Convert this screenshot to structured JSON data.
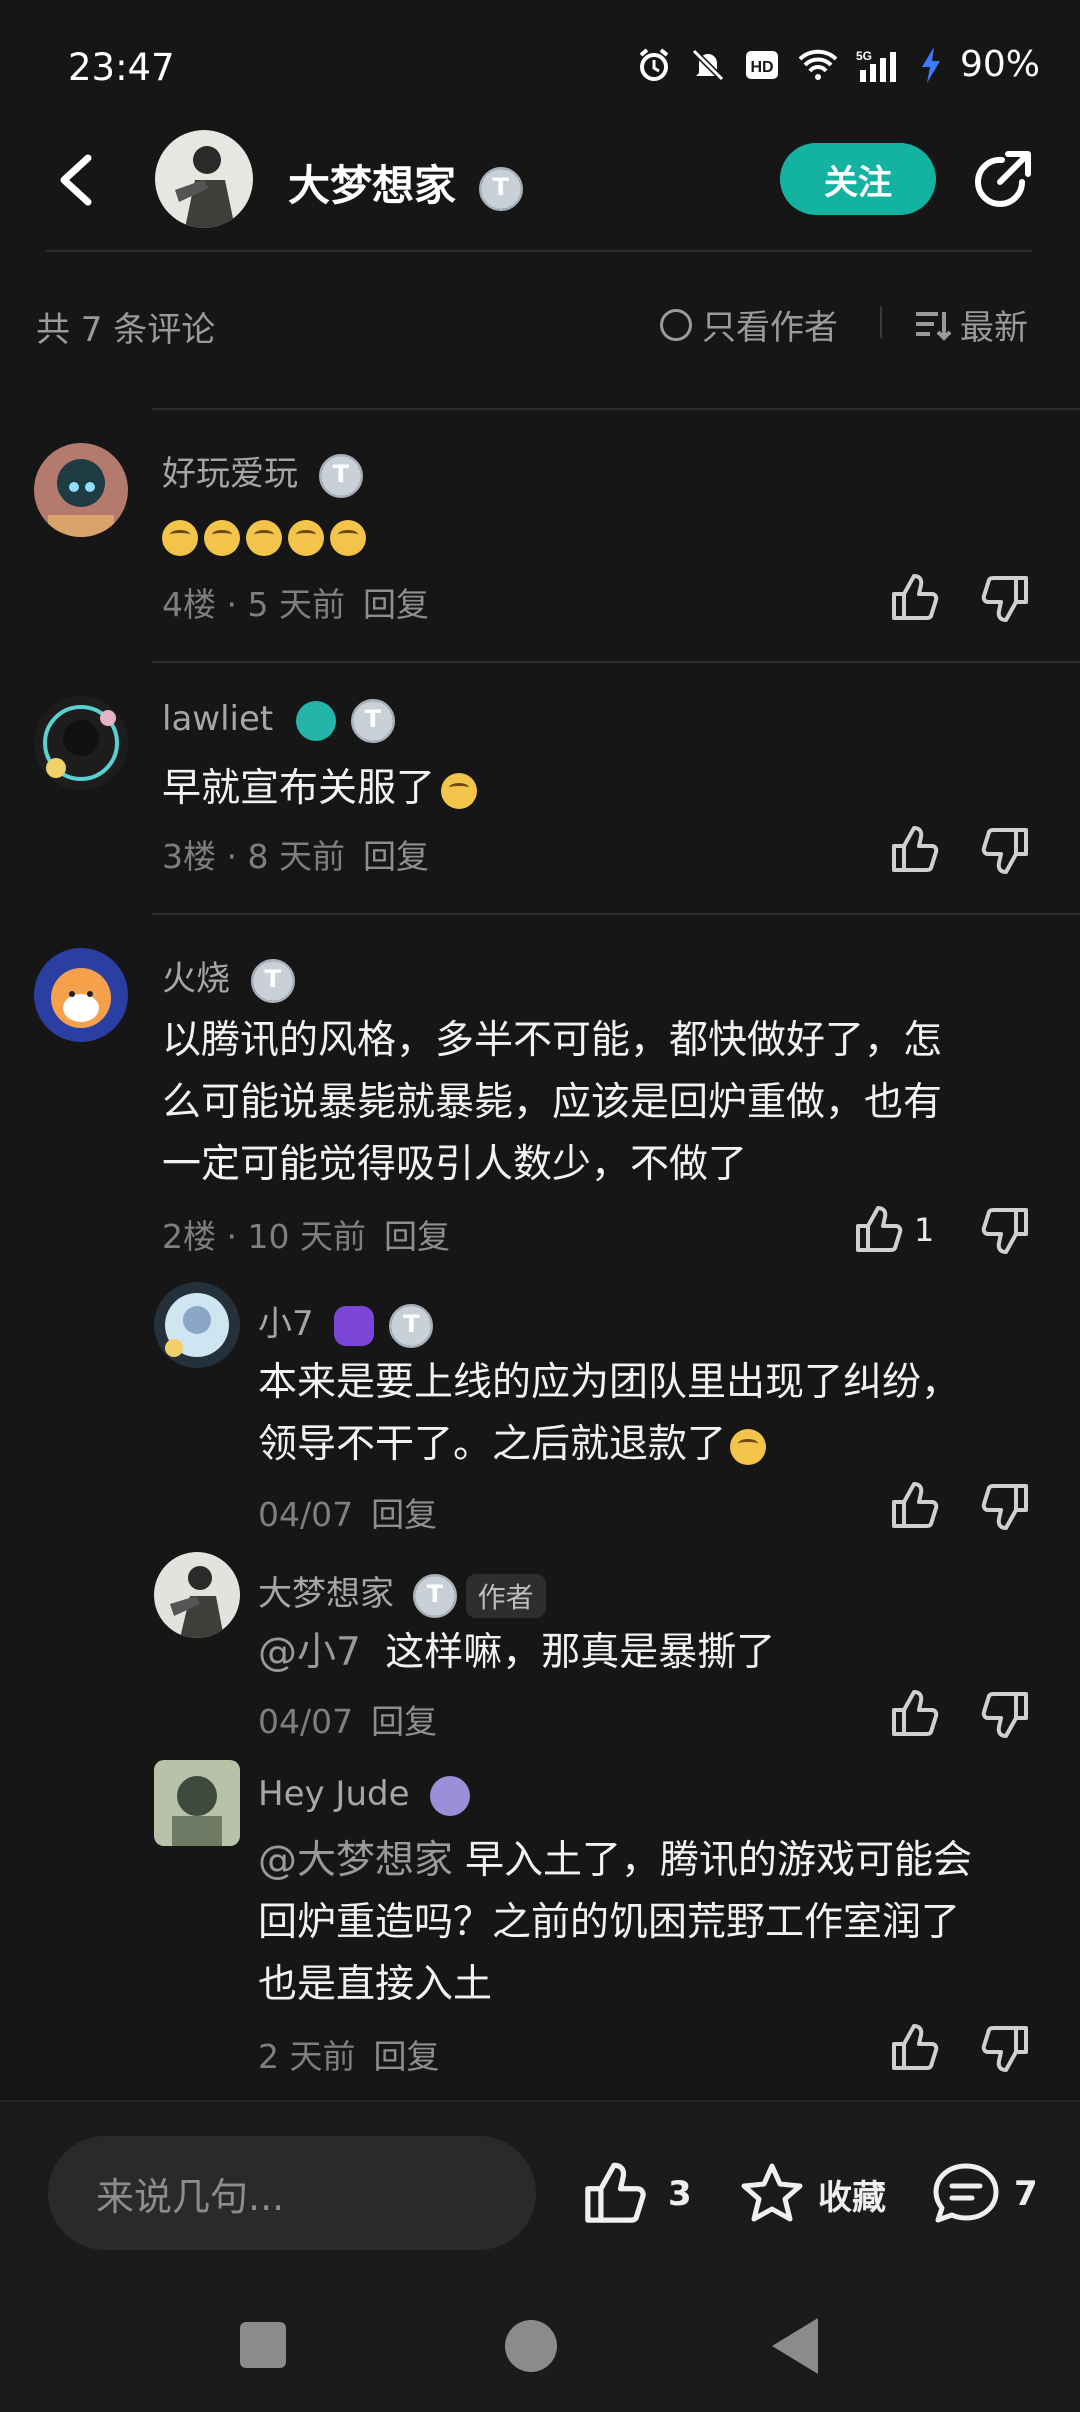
{
  "status": {
    "time": "23:47",
    "battery": "90%",
    "network": "5G",
    "hd": "HD"
  },
  "header": {
    "name": "大梦想家",
    "follow_label": "关注"
  },
  "filter": {
    "count": "共 7 条评论",
    "only_author": "只看作者",
    "sort": "最新"
  },
  "comments": [
    {
      "user": "好玩爱玩",
      "content": "",
      "emoji_count": 5,
      "floor": "4楼 · 5 天前",
      "reply": "回复",
      "likes": ""
    },
    {
      "user": "lawliet",
      "content": "早就宣布关服了",
      "floor": "3楼 · 8 天前",
      "reply": "回复",
      "likes": ""
    },
    {
      "user": "火烧",
      "content_lines": [
        "以腾讯的风格，多半不可能，都快做好了，怎",
        "么可能说暴毙就暴毙，应该是回炉重做，也有",
        "一定可能觉得吸引人数少，不做了"
      ],
      "floor": "2楼 · 10 天前",
      "reply": "回复",
      "likes": "1"
    }
  ],
  "replies": [
    {
      "user": "小7",
      "content_lines": [
        "本来是要上线的应为团队里出现了纠纷，",
        "领导不干了。之后就退款了"
      ],
      "date": "04/07",
      "reply": "回复"
    },
    {
      "user": "大梦想家",
      "tag": "作者",
      "mention": "@小7",
      "content": "这样嘛，那真是暴撕了",
      "date": "04/07",
      "reply": "回复"
    },
    {
      "user": "Hey Jude",
      "mention": "@大梦想家",
      "content_lines": [
        "早入土了，腾讯的游戏可能会",
        "回炉重造吗？之前的饥困荒野工作室润了",
        "也是直接入土"
      ],
      "date": "2 天前",
      "reply": "回复"
    }
  ],
  "bottom": {
    "input_placeholder": "来说几句...",
    "like_count": "3",
    "favorite_label": "收藏",
    "comment_count": "7"
  },
  "colors": {
    "accent": "#14b3a1",
    "background": "#161616",
    "text_secondary": "#9a9a9a"
  }
}
